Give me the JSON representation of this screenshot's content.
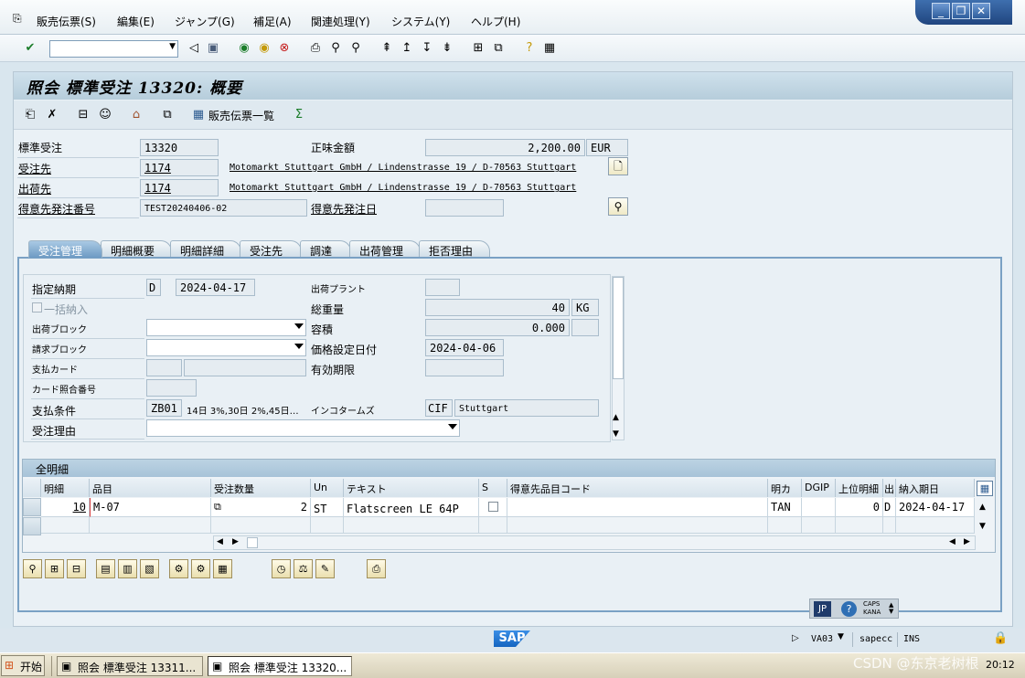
{
  "menu": [
    "販売伝票(S)",
    "編集(E)",
    "ジャンプ(G)",
    "補足(A)",
    "関連処理(Y)",
    "システム(Y)",
    "ヘルプ(H)"
  ],
  "title": "照会 標準受注 13320: 概要",
  "app_toolbar": {
    "doc_list_label": "販売伝票一覧"
  },
  "header": {
    "order_type_label": "標準受注",
    "order_no": "13320",
    "net_label": "正味金額",
    "net_value": "2,200.00",
    "currency": "EUR",
    "soldto_label": "受注先",
    "soldto_no": "1174",
    "soldto_addr": "Motomarkt Stuttgart GmbH / Lindenstrasse 19 / D-70563 Stuttgart",
    "shipto_label": "出荷先",
    "shipto_no": "1174",
    "shipto_addr": "Motomarkt Stuttgart GmbH / Lindenstrasse 19 / D-70563 Stuttgart",
    "po_label": "得意先発注番号",
    "po_value": "TEST20240406-02",
    "po_date_label": "得意先発注日"
  },
  "tabs": [
    "受注管理",
    "明細概要",
    "明細詳細",
    "受注先",
    "調達",
    "出荷管理",
    "拒否理由"
  ],
  "sales": {
    "req_date_label": "指定納期",
    "req_date_type": "D",
    "req_date": "2024-04-17",
    "plant_label": "出荷プラント",
    "complete_label": "一括納入",
    "weight_label": "総重量",
    "weight": "40",
    "weight_unit": "KG",
    "block_label": "出荷ブロック",
    "volume_label": "容積",
    "volume": "0.000",
    "billblock_label": "請求ブロック",
    "pricedate_label": "価格設定日付",
    "pricedate": "2024-04-06",
    "card_label": "支払カード",
    "valid_label": "有効期限",
    "cardcheck_label": "カード照合番号",
    "terms_label": "支払条件",
    "terms_code": "ZB01",
    "terms_text": "14日 3%,30日 2%,45日…",
    "incoterms_label": "インコタームズ",
    "incoterms_code": "CIF",
    "incoterms_place": "Stuttgart",
    "reason_label": "受注理由"
  },
  "grid": {
    "title": "全明細",
    "columns": [
      "明細",
      "品目",
      "受注数量",
      "Un",
      "テキスト",
      "S",
      "得意先品目コード",
      "明カ",
      "DGIP",
      "上位明細",
      "出",
      "納入期日"
    ],
    "rows": [
      {
        "item": "10",
        "material": "M-07",
        "qty": "2",
        "unit": "ST",
        "text": "Flatscreen LE 64P",
        "cat": "TAN",
        "hl": "0",
        "dl": "D",
        "date": "2024-04-17"
      }
    ]
  },
  "status": {
    "tcode": "VA03",
    "system": "sapecc",
    "mode": "INS",
    "lang": "JP",
    "caps": "CAPS",
    "kana": "KANA"
  },
  "taskbar": {
    "start": "开始",
    "task1": "照会 標準受注 13311...",
    "task2": "照会 標準受注 13320...",
    "time": "20:12",
    "watermark": "CSDN @东京老树根"
  }
}
